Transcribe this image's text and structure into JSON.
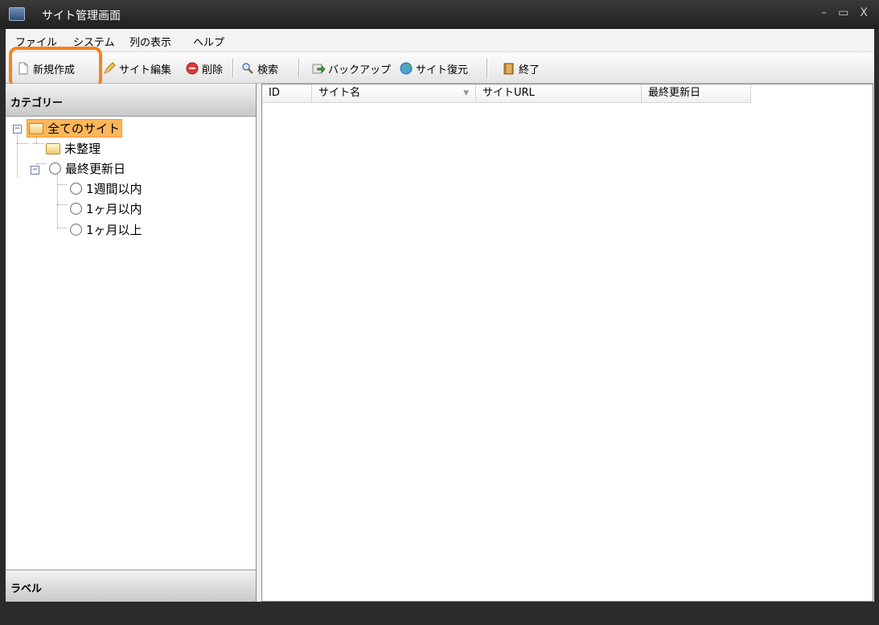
{
  "window": {
    "title": "サイト管理画面",
    "minimize": "–",
    "maximize": "▭",
    "close": "X"
  },
  "menu": [
    "ファイル",
    "システム",
    "列の表示",
    "ヘルプ"
  ],
  "toolbar": {
    "new": "新規作成",
    "edit": "サイト編集",
    "delete": "削除",
    "search": "検索",
    "backup": "バックアップ",
    "restore": "サイト復元",
    "exit": "終了"
  },
  "category_pane": {
    "header": "カテゴリー",
    "tree": {
      "all": "全てのサイト",
      "unsorted": "未整理",
      "last_updated": "最終更新日",
      "children": [
        "1週間以内",
        "1ヶ月以内",
        "1ヶ月以上"
      ]
    }
  },
  "label_pane": {
    "header": "ラベル"
  },
  "grid": {
    "columns": [
      "ID",
      "サイト名",
      "サイトURL",
      "最終更新日"
    ]
  },
  "colors": {
    "highlight": "#f5821f",
    "selection": "#ffb65a"
  }
}
